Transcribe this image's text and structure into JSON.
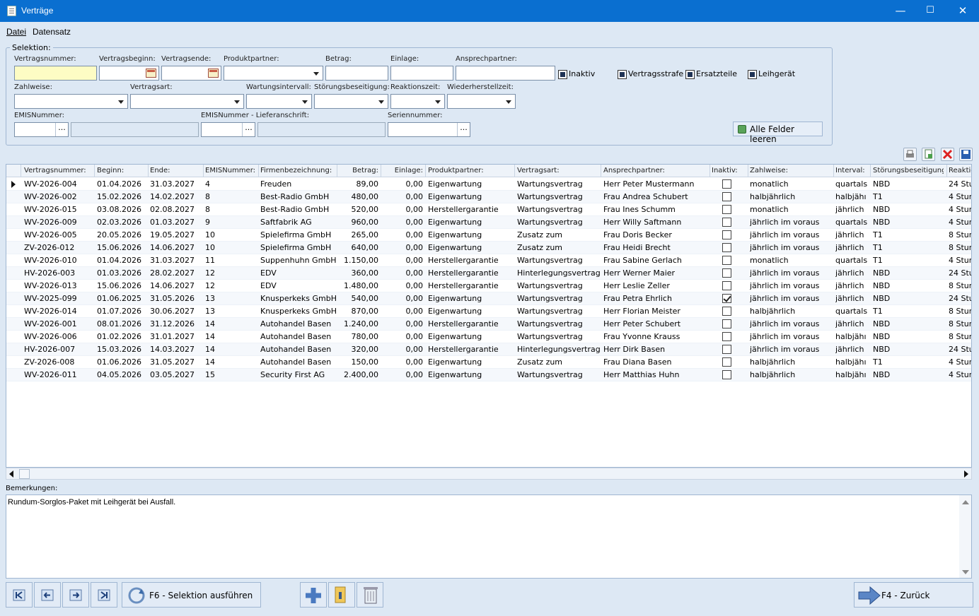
{
  "window": {
    "title": "Verträge",
    "minimize": "—",
    "maximize": "☐",
    "close": "✕"
  },
  "menu": {
    "file": "Datei",
    "record": "Datensatz"
  },
  "selection": {
    "legend": "Selektion:",
    "contract_number": "Vertragsnummer:",
    "contract_start": "Vertragsbeginn:",
    "contract_end": "Vertragsende:",
    "product_partner": "Produktpartner:",
    "amount": "Betrag:",
    "deposit": "Einlage:",
    "contact": "Ansprechpartner:",
    "inactive": "Inaktiv",
    "penalty": "Vertragsstrafe",
    "spare_parts": "Ersatzteile",
    "loaner": "Leihgerät",
    "payment": "Zahlweise:",
    "contract_type": "Vertragsart:",
    "maint_interval": "Wartungsintervall:",
    "fault_fix": "Störungsbeseitigung:",
    "reaction": "Reaktionszeit:",
    "restore": "Wiederherstellzeit:",
    "emis": "EMISNummer:",
    "emis_delivery": "EMISNummer - Lieferanschrift:",
    "serial": "Seriennummer:",
    "ellipsis": "...",
    "clear_all": "Alle Felder leeren"
  },
  "grid": {
    "headers": [
      "Vertragsnummer:",
      "Beginn:",
      "Ende:",
      "EMISNummer:",
      "Firmenbezeichnung:",
      "Betrag:",
      "Einlage:",
      "Produktpartner:",
      "Vertragsart:",
      "Ansprechpartner:",
      "Inaktiv:",
      "Zahlweise:",
      "Interval:",
      "Störungsbeseitigung:",
      "Reaktio"
    ],
    "rows": [
      {
        "nr": "WV-2026-004",
        "begin": "01.04.2026",
        "end": "31.03.2027",
        "emis": "4",
        "firm": "Freuden",
        "amount": "89,00",
        "deposit": "0,00",
        "partner": "Eigenwartung",
        "type": "Wartungsvertrag",
        "contact": "Herr Peter Mustermann",
        "inactive": false,
        "payment": "monatlich",
        "interval": "quartals",
        "fault": "NBD",
        "reaction": "24 Stu"
      },
      {
        "nr": "WV-2026-002",
        "begin": "15.02.2026",
        "end": "14.02.2027",
        "emis": "8",
        "firm": "Best-Radio GmbH",
        "amount": "480,00",
        "deposit": "0,00",
        "partner": "Eigenwartung",
        "type": "Wartungsvertrag",
        "contact": "Frau Andrea Schubert",
        "inactive": false,
        "payment": "halbjährlich",
        "interval": "halbjähı",
        "fault": "T1",
        "reaction": "4 Stun"
      },
      {
        "nr": "WV-2026-015",
        "begin": "03.08.2026",
        "end": "02.08.2027",
        "emis": "8",
        "firm": "Best-Radio GmbH",
        "amount": "520,00",
        "deposit": "0,00",
        "partner": "Herstellergarantie",
        "type": "Wartungsvertrag",
        "contact": "Frau Ines Schumm",
        "inactive": false,
        "payment": "monatlich",
        "interval": "jährlich",
        "fault": "NBD",
        "reaction": "4 Stun"
      },
      {
        "nr": "WV-2026-009",
        "begin": "02.03.2026",
        "end": "01.03.2027",
        "emis": "9",
        "firm": "Saftfabrik AG",
        "amount": "960,00",
        "deposit": "0,00",
        "partner": "Eigenwartung",
        "type": "Wartungsvertrag",
        "contact": "Herr Willy Saftmann",
        "inactive": false,
        "payment": "jährlich im voraus",
        "interval": "quartals",
        "fault": "NBD",
        "reaction": "4 Stun"
      },
      {
        "nr": "WV-2026-005",
        "begin": "20.05.2026",
        "end": "19.05.2027",
        "emis": "10",
        "firm": "Spielefirma GmbH",
        "amount": "265,00",
        "deposit": "0,00",
        "partner": "Eigenwartung",
        "type": "Zusatz zum",
        "contact": "Frau Doris Becker",
        "inactive": false,
        "payment": "jährlich im voraus",
        "interval": "jährlich",
        "fault": "T1",
        "reaction": "8 Stun"
      },
      {
        "nr": "ZV-2026-012",
        "begin": "15.06.2026",
        "end": "14.06.2027",
        "emis": "10",
        "firm": "Spielefirma GmbH",
        "amount": "640,00",
        "deposit": "0,00",
        "partner": "Eigenwartung",
        "type": "Zusatz zum",
        "contact": "Frau Heidi Brecht",
        "inactive": false,
        "payment": "jährlich im voraus",
        "interval": "jährlich",
        "fault": "T1",
        "reaction": "8 Stun"
      },
      {
        "nr": "WV-2026-010",
        "begin": "01.04.2026",
        "end": "31.03.2027",
        "emis": "11",
        "firm": "Suppenhuhn GmbH",
        "amount": "1.150,00",
        "deposit": "0,00",
        "partner": "Herstellergarantie",
        "type": "Wartungsvertrag",
        "contact": "Frau Sabine Gerlach",
        "inactive": false,
        "payment": "monatlich",
        "interval": "quartals",
        "fault": "T1",
        "reaction": "4 Stun"
      },
      {
        "nr": "HV-2026-003",
        "begin": "01.03.2026",
        "end": "28.02.2027",
        "emis": "12",
        "firm": "EDV",
        "amount": "360,00",
        "deposit": "0,00",
        "partner": "Herstellergarantie",
        "type": "Hinterlegungsvertrag",
        "contact": "Herr Werner Maier",
        "inactive": false,
        "payment": "jährlich im voraus",
        "interval": "jährlich",
        "fault": "NBD",
        "reaction": "24 Stu"
      },
      {
        "nr": "WV-2026-013",
        "begin": "15.06.2026",
        "end": "14.06.2027",
        "emis": "12",
        "firm": "EDV",
        "amount": "1.480,00",
        "deposit": "0,00",
        "partner": "Herstellergarantie",
        "type": "Wartungsvertrag",
        "contact": "Herr Leslie Zeller",
        "inactive": false,
        "payment": "jährlich im voraus",
        "interval": "jährlich",
        "fault": "NBD",
        "reaction": "8 Stun"
      },
      {
        "nr": "WV-2025-099",
        "begin": "01.06.2025",
        "end": "31.05.2026",
        "emis": "13",
        "firm": "Knusperkeks GmbH",
        "amount": "540,00",
        "deposit": "0,00",
        "partner": "Eigenwartung",
        "type": "Wartungsvertrag",
        "contact": "Frau Petra Ehrlich",
        "inactive": true,
        "payment": "jährlich im voraus",
        "interval": "jährlich",
        "fault": "NBD",
        "reaction": "24 Stu"
      },
      {
        "nr": "WV-2026-014",
        "begin": "01.07.2026",
        "end": "30.06.2027",
        "emis": "13",
        "firm": "Knusperkeks GmbH",
        "amount": "870,00",
        "deposit": "0,00",
        "partner": "Eigenwartung",
        "type": "Wartungsvertrag",
        "contact": "Herr Florian Meister",
        "inactive": false,
        "payment": "halbjährlich",
        "interval": "quartals",
        "fault": "T1",
        "reaction": "8 Stun"
      },
      {
        "nr": "WV-2026-001",
        "begin": "08.01.2026",
        "end": "31.12.2026",
        "emis": "14",
        "firm": "Autohandel Basen",
        "amount": "1.240,00",
        "deposit": "0,00",
        "partner": "Herstellergarantie",
        "type": "Wartungsvertrag",
        "contact": "Herr Peter Schubert",
        "inactive": false,
        "payment": "jährlich im voraus",
        "interval": "jährlich",
        "fault": "NBD",
        "reaction": "8 Stun"
      },
      {
        "nr": "WV-2026-006",
        "begin": "01.02.2026",
        "end": "31.01.2027",
        "emis": "14",
        "firm": "Autohandel Basen",
        "amount": "780,00",
        "deposit": "0,00",
        "partner": "Eigenwartung",
        "type": "Wartungsvertrag",
        "contact": "Frau Yvonne Krauss",
        "inactive": false,
        "payment": "jährlich im voraus",
        "interval": "halbjähı",
        "fault": "NBD",
        "reaction": "8 Stun"
      },
      {
        "nr": "HV-2026-007",
        "begin": "15.03.2026",
        "end": "14.03.2027",
        "emis": "14",
        "firm": "Autohandel Basen",
        "amount": "320,00",
        "deposit": "0,00",
        "partner": "Herstellergarantie",
        "type": "Hinterlegungsvertrag",
        "contact": "Herr Dirk Basen",
        "inactive": false,
        "payment": "jährlich im voraus",
        "interval": "jährlich",
        "fault": "NBD",
        "reaction": "24 Stu"
      },
      {
        "nr": "ZV-2026-008",
        "begin": "01.06.2026",
        "end": "31.05.2027",
        "emis": "14",
        "firm": "Autohandel Basen",
        "amount": "150,00",
        "deposit": "0,00",
        "partner": "Eigenwartung",
        "type": "Zusatz zum",
        "contact": "Frau Diana Basen",
        "inactive": false,
        "payment": "halbjährlich",
        "interval": "halbjähı",
        "fault": "T1",
        "reaction": "4 Stun"
      },
      {
        "nr": "WV-2026-011",
        "begin": "04.05.2026",
        "end": "03.05.2027",
        "emis": "15",
        "firm": "Security First AG",
        "amount": "2.400,00",
        "deposit": "0,00",
        "partner": "Eigenwartung",
        "type": "Wartungsvertrag",
        "contact": "Herr Matthias Huhn",
        "inactive": false,
        "payment": "halbjährlich",
        "interval": "halbjähı",
        "fault": "NBD",
        "reaction": "4 Stun"
      }
    ]
  },
  "remarks": {
    "label": "Bemerkungen:",
    "text": "Rundum-Sorglos-Paket mit Leihgerät bei Ausfall."
  },
  "footer": {
    "run_selection": "F6 - Selektion ausführen",
    "back": "F4 - Zurück"
  },
  "colors": {
    "titlebar": "#0a6fd0",
    "background": "#dde8f4",
    "highlight_input": "#fdfcc4"
  }
}
